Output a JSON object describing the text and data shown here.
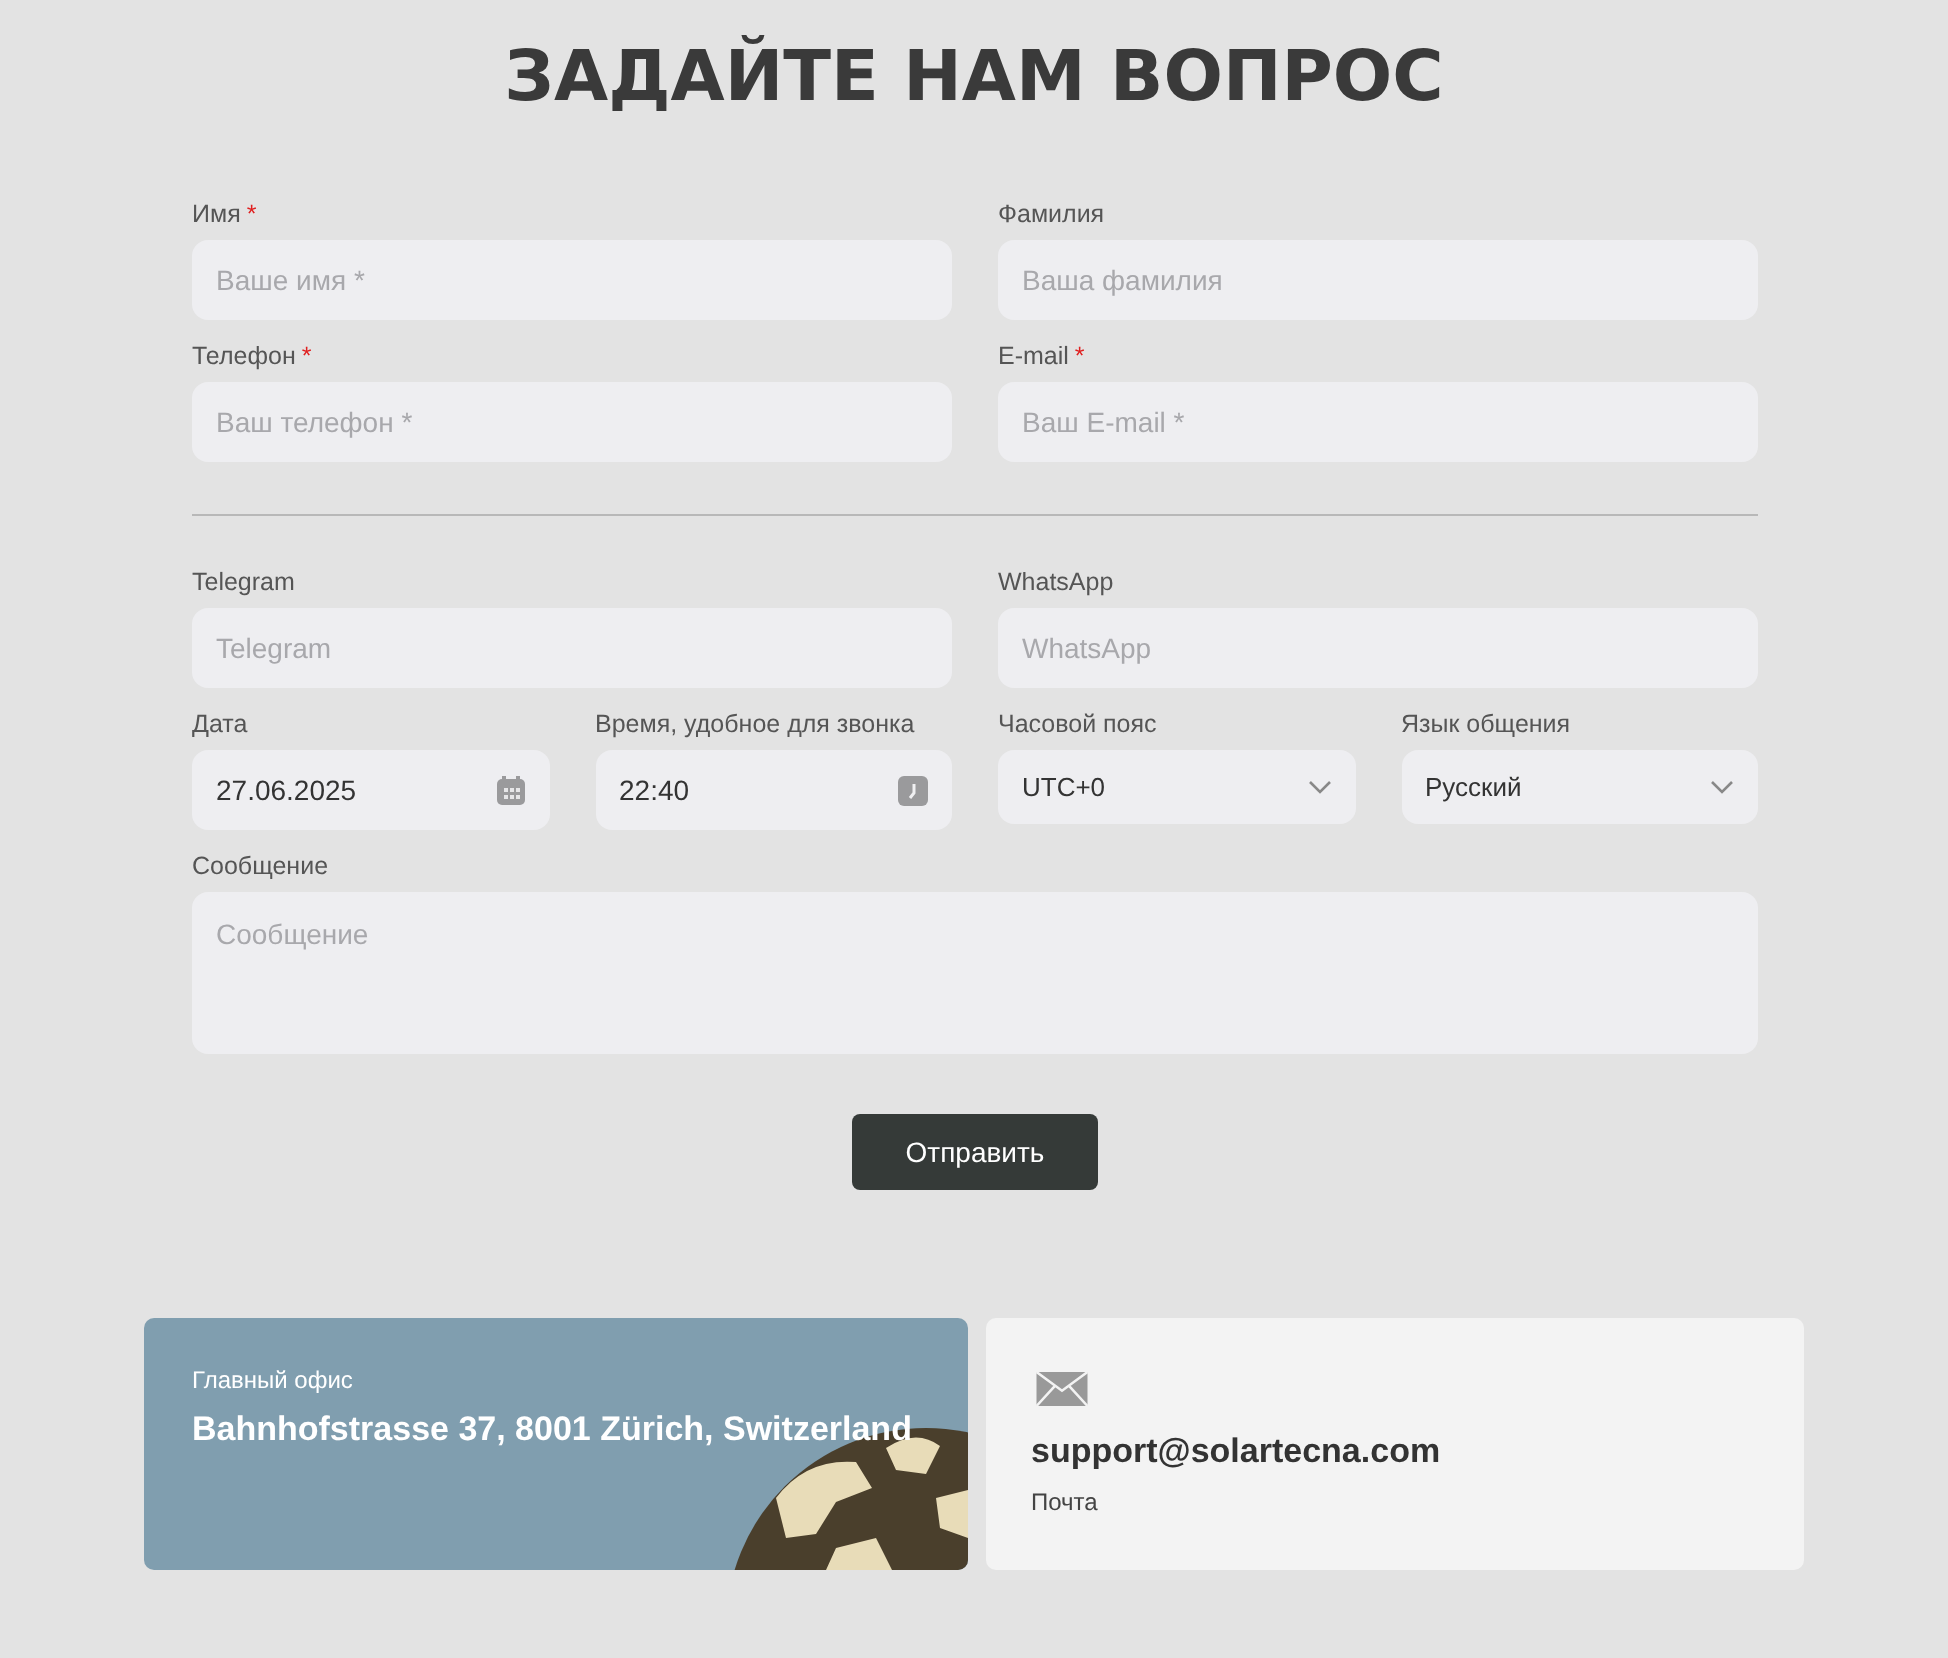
{
  "title": "ЗАДАЙТЕ НАМ ВОПРОС",
  "groups": [
    [
      [
        {
          "kind": "text",
          "label": "Имя",
          "required_mark": "*",
          "placeholder": "Ваше имя *"
        },
        {
          "kind": "text",
          "label": "Фамилия",
          "placeholder": "Ваша фамилия"
        }
      ],
      [
        {
          "kind": "text",
          "label": "Телефон",
          "required_mark": "*",
          "placeholder": "Ваш телефон *"
        },
        {
          "kind": "text",
          "label": "E-mail",
          "required_mark": "*",
          "placeholder": "Ваш E-mail *"
        }
      ]
    ],
    [
      [
        {
          "kind": "text",
          "label": "Telegram",
          "placeholder": "Telegram"
        },
        {
          "kind": "text",
          "label": "WhatsApp",
          "placeholder": "WhatsApp"
        }
      ],
      [
        {
          "kind": "date",
          "label": "Дата",
          "value": "27.06.2025"
        },
        {
          "kind": "time",
          "label": "Время, удобное для звонка",
          "value": "22:40"
        },
        {
          "kind": "select",
          "label": "Часовой пояс",
          "value": "UTC+0"
        },
        {
          "kind": "select",
          "label": "Язык общения",
          "value": "Русский"
        }
      ],
      [
        {
          "kind": "textarea",
          "label": "Сообщение",
          "placeholder": "Сообщение"
        }
      ]
    ]
  ],
  "submit": "Отправить",
  "office": {
    "label": "Главный офис",
    "address": "Bahnhofstrasse 37, 8001 Zürich, Switzerland"
  },
  "contact": {
    "email": "support@solartecna.com",
    "label": "Почта"
  }
}
